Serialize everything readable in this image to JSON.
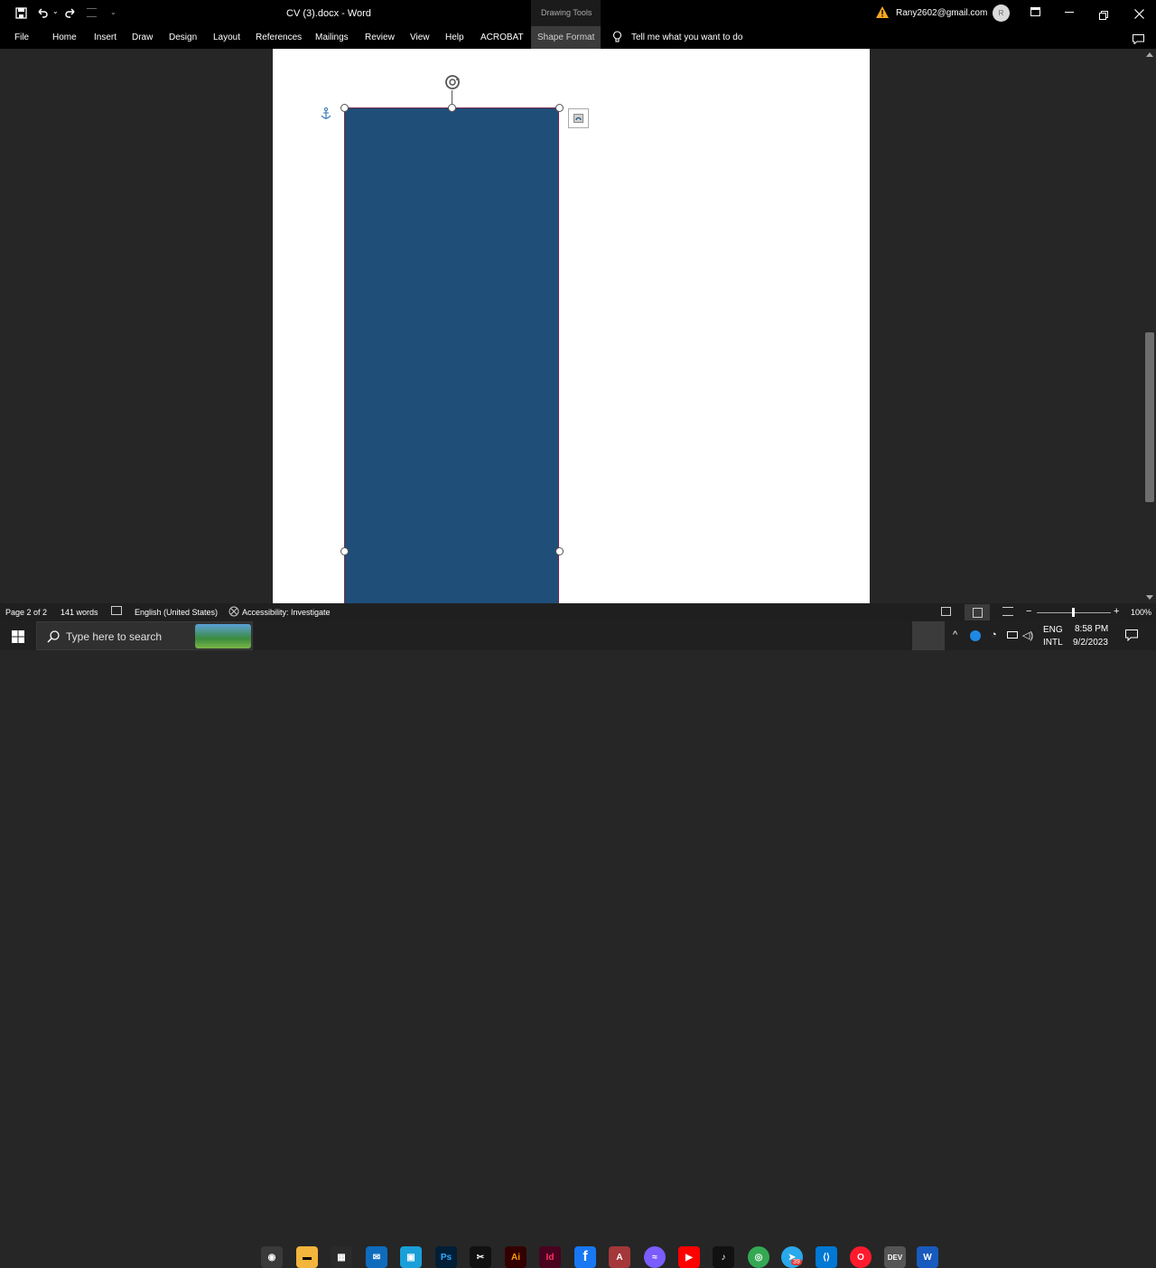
{
  "titlebar": {
    "document_title": "CV (3).docx  -  Word",
    "context_label": "Drawing Tools",
    "account_email": "Rany2602@gmail.com",
    "avatar_initial": "R"
  },
  "ribbon": {
    "tabs": [
      "File",
      "Home",
      "Insert",
      "Draw",
      "Design",
      "Layout",
      "References",
      "Mailings",
      "Review",
      "View",
      "Help",
      "ACROBAT",
      "Shape Format"
    ],
    "active_tab": "Shape Format",
    "tell_me": "Tell me what you want to do"
  },
  "document": {
    "shape_fill": "#1f4e79",
    "shape_outline": "#7a2a52"
  },
  "statusbar": {
    "page": "Page 2 of 2",
    "words": "141 words",
    "language": "English (United States)",
    "accessibility": "Accessibility: Investigate",
    "zoom": "100%",
    "zoom_minus": "−",
    "zoom_plus": "+"
  },
  "taskbar": {
    "search_placeholder": "Type here to search",
    "lang_top": "ENG",
    "lang_bottom": "INTL",
    "time": "8:58 PM",
    "date": "9/2/2023",
    "app_icons": [
      "camera-icon",
      "file-explorer-icon",
      "store-icon",
      "mail-icon",
      "snagit-icon",
      "photoshop-icon",
      "capcut-icon",
      "illustrator-icon",
      "indesign-icon",
      "facebook-icon",
      "access-icon",
      "messenger-icon",
      "youtube-icon",
      "tiktok-icon",
      "chrome-icon",
      "telegram-icon",
      "vscode-icon",
      "opera-icon",
      "dev-icon",
      "word-icon"
    ],
    "telegram_badge": "39"
  },
  "colors": {
    "accent": "#1f4e79",
    "titlebar_bg": "#000000",
    "canvas_bg": "#262626",
    "taskbar_bg": "#202020"
  }
}
